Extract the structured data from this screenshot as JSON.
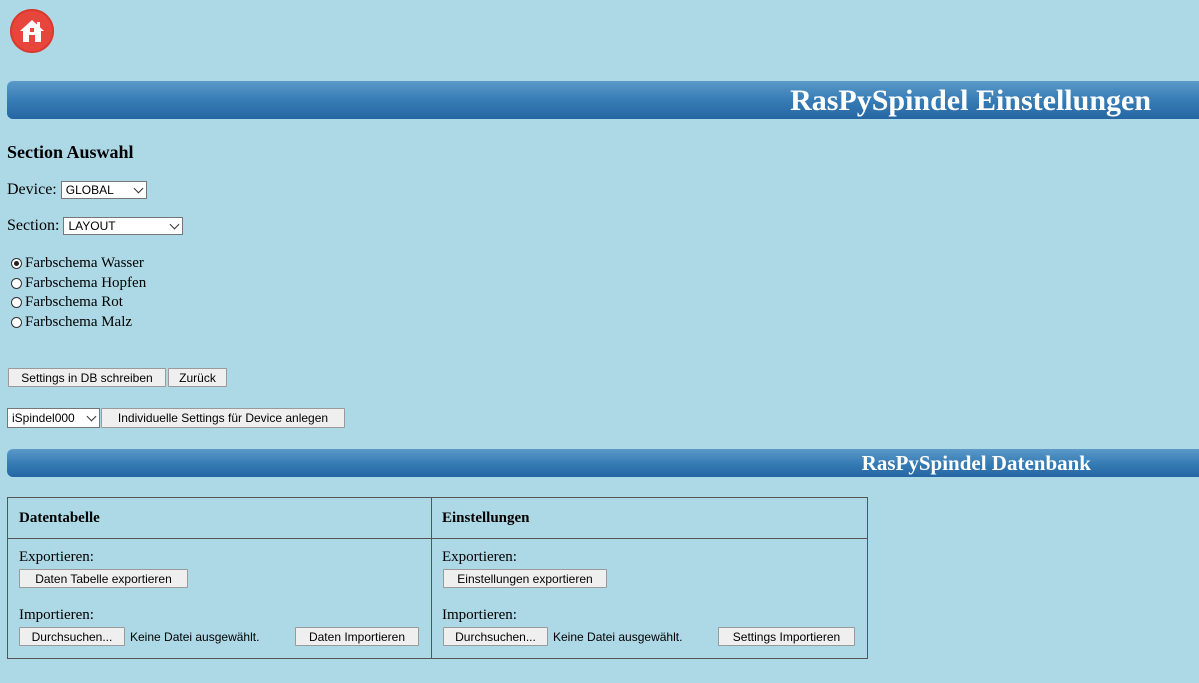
{
  "header": {
    "home_icon": "home-icon",
    "home_color": "#e8463c",
    "title": "RasPySpindel Einstellungen"
  },
  "section": {
    "heading": "Section Auswahl",
    "device_label": "Device:",
    "device_value": "GLOBAL",
    "section_label": "Section:",
    "section_value": "LAYOUT",
    "options": [
      {
        "label": "Farbschema Wasser",
        "checked": true
      },
      {
        "label": "Farbschema Hopfen",
        "checked": false
      },
      {
        "label": "Farbschema Rot",
        "checked": false
      },
      {
        "label": "Farbschema Malz",
        "checked": false
      }
    ],
    "write_button": "Settings in DB schreiben",
    "back_button": "Zurück",
    "spindel_value": "iSpindel000",
    "individual_button": "Individuelle Settings für Device anlegen"
  },
  "database": {
    "title": "RasPySpindel Datenbank",
    "left": {
      "header": "Datentabelle",
      "export_label": "Exportieren:",
      "export_button": "Daten Tabelle exportieren",
      "import_label": "Importieren:",
      "browse_button": "Durchsuchen...",
      "no_file": "Keine Datei ausgewählt.",
      "import_button": "Daten Importieren"
    },
    "right": {
      "header": "Einstellungen",
      "export_label": "Exportieren:",
      "export_button": "Einstellungen exportieren",
      "import_label": "Importieren:",
      "browse_button": "Durchsuchen...",
      "no_file": "Keine Datei ausgewählt.",
      "import_button": "Settings Importieren"
    }
  },
  "colors": {
    "background": "#add8e6",
    "banner": "#2f74ae"
  }
}
